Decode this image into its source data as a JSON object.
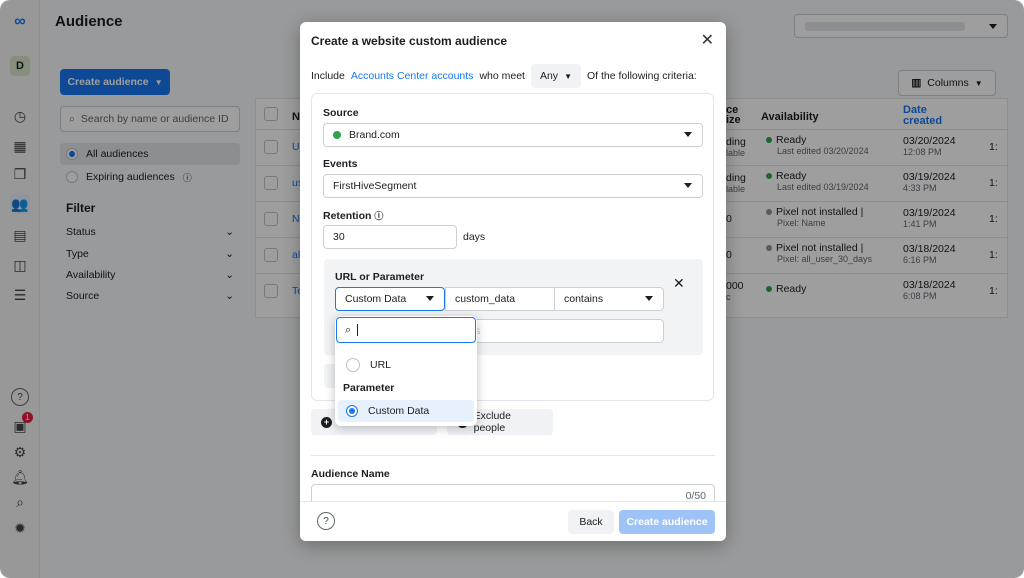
{
  "app": {
    "title": "Audience"
  },
  "rail": {
    "badge_count": "1",
    "avatar_letter": "D"
  },
  "left": {
    "create_label": "Create audience",
    "search_placeholder": "Search by name or audience ID",
    "all_audiences": "All audiences",
    "expiring": "Expiring audiences",
    "filter_title": "Filter",
    "filters": [
      "Status",
      "Type",
      "Availability",
      "Source"
    ]
  },
  "table": {
    "columns_label": "Columns",
    "headers": {
      "name": "N",
      "size": "ce\nize",
      "availability": "Availability",
      "date": "Date created"
    },
    "rows": [
      {
        "name": "U",
        "size": "ding",
        "size_sub": "lable",
        "status": "Ready",
        "status_sub": "Last edited 03/20/2024",
        "status_color": "#31a24c",
        "date": "03/20/2024",
        "time": "12:08 PM",
        "extra": "1:"
      },
      {
        "name": "us",
        "size": "ding",
        "size_sub": "lable",
        "status": "Ready",
        "status_sub": "Last edited 03/19/2024",
        "status_color": "#31a24c",
        "date": "03/19/2024",
        "time": "4:33 PM",
        "extra": "1:"
      },
      {
        "name": "N",
        "size": "0",
        "size_sub": "",
        "status": "Pixel not installed |",
        "status_sub": "Pixel: Name",
        "status_color": "#8d949e",
        "date": "03/19/2024",
        "time": "1:41 PM",
        "extra": "1:"
      },
      {
        "name": "al",
        "size": "0",
        "size_sub": "",
        "status": "Pixel not installed |",
        "status_sub": "Pixel: all_user_30_days",
        "status_color": "#8d949e",
        "date": "03/18/2024",
        "time": "6:16 PM",
        "extra": "1:"
      },
      {
        "name": "Te",
        "size": "000",
        "size_sub": "c",
        "status": "Ready",
        "status_sub": "",
        "status_color": "#31a24c",
        "date": "03/18/2024",
        "time": "6:08 PM",
        "extra": "1:"
      }
    ]
  },
  "modal": {
    "title": "Create a website custom audience",
    "include_prefix": "Include",
    "include_link": "Accounts Center accounts",
    "include_mid": "who meet",
    "any": "Any",
    "include_suffix": "Of the following criteria:",
    "source_label": "Source",
    "source_value": "Brand.com",
    "events_label": "Events",
    "events_value": "FirstHiveSegment",
    "retention_label": "Retention",
    "retention_value": "30",
    "retention_unit": "days",
    "url_label": "URL or Parameter",
    "param_type": "Custom Data",
    "param_key": "custom_data",
    "operator": "contains",
    "dropdown": {
      "search_value": "",
      "url_option": "URL",
      "group_label": "Parameter",
      "custom_option": "Custom Data"
    },
    "exclude_label": "Exclude people",
    "audience_name_label": "Audience Name",
    "char_count": "0/50",
    "back_label": "Back",
    "create_label": "Create audience"
  }
}
